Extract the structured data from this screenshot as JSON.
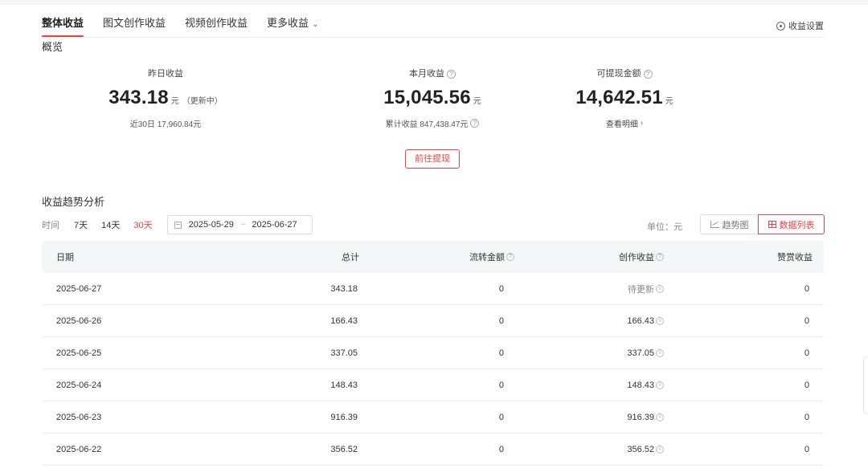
{
  "tabs": [
    {
      "label": "整体收益",
      "active": true
    },
    {
      "label": "图文创作收益",
      "active": false
    },
    {
      "label": "视频创作收益",
      "active": false
    },
    {
      "label": "更多收益",
      "active": false
    }
  ],
  "settings_label": "收益设置",
  "overview_title": "概览",
  "stats": {
    "yesterday": {
      "label": "昨日收益",
      "value": "343.18",
      "unit": "元",
      "status": "（更新中）",
      "sub": "近30日 17,960.84元"
    },
    "month": {
      "label": "本月收益",
      "value": "15,045.56",
      "unit": "元",
      "sub": "累计收益 847,438.47元"
    },
    "withdrawable": {
      "label": "可提现金额",
      "value": "14,642.51",
      "unit": "元",
      "sub": "查看明细"
    }
  },
  "withdraw_button": "前往提现",
  "trend_title": "收益趋势分析",
  "filter": {
    "time_label": "时间",
    "ranges": [
      "7天",
      "14天",
      "30天"
    ],
    "active_range": "30天",
    "date_start": "2025-05-29",
    "date_sep": "~",
    "date_end": "2025-06-27"
  },
  "unit_label": "单位：元",
  "view_buttons": {
    "trend": "趋势图",
    "list": "数据列表"
  },
  "table": {
    "headers": [
      "日期",
      "总计",
      "流转金额",
      "创作收益",
      "赞赏收益"
    ],
    "rows": [
      {
        "date": "2025-06-27",
        "total": "343.18",
        "flow": "0",
        "creation": "待更新",
        "tip": "0"
      },
      {
        "date": "2025-06-26",
        "total": "166.43",
        "flow": "0",
        "creation": "166.43",
        "tip": "0"
      },
      {
        "date": "2025-06-25",
        "total": "337.05",
        "flow": "0",
        "creation": "337.05",
        "tip": "0"
      },
      {
        "date": "2025-06-24",
        "total": "148.43",
        "flow": "0",
        "creation": "148.43",
        "tip": "0"
      },
      {
        "date": "2025-06-23",
        "total": "916.39",
        "flow": "0",
        "creation": "916.39",
        "tip": "0"
      },
      {
        "date": "2025-06-22",
        "total": "356.52",
        "flow": "0",
        "creation": "356.52",
        "tip": "0"
      }
    ]
  },
  "colors": {
    "accent": "#f04142",
    "header_bg": "#f5f6f7",
    "divider": "#eeeeee"
  }
}
